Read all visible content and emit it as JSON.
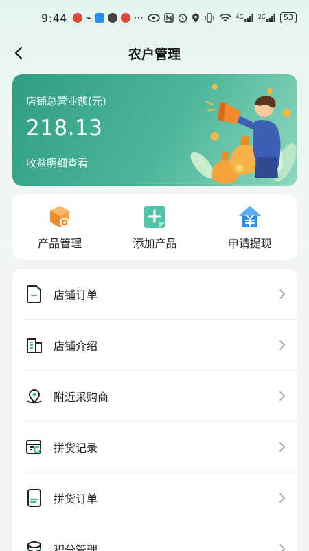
{
  "status_bar": {
    "time": "9:44",
    "left_icons": [
      "weibo-icon",
      "usb-icon",
      "shield-icon",
      "wechat-icon",
      "weibo-icon",
      "more-dots-icon"
    ],
    "right_icons": [
      "eye-icon",
      "nfc-icon",
      "alarm-icon",
      "location-icon",
      "vibrate-icon",
      "wifi-icon",
      "signal-4g-icon",
      "signal-2g-icon"
    ],
    "network_1": "4G",
    "network_2": "2G",
    "battery": "53"
  },
  "header": {
    "title": "农户管理",
    "back_icon": "chevron-left-icon"
  },
  "revenue": {
    "label": "店铺总营业额(元)",
    "amount": "218.13",
    "link": "收益明细查看"
  },
  "quick_actions": [
    {
      "label": "产品管理",
      "icon": "product-box-gear-icon",
      "color": "#f08a2a"
    },
    {
      "label": "添加产品",
      "icon": "add-document-icon",
      "color": "#3cbca0"
    },
    {
      "label": "申请提现",
      "icon": "withdraw-yuan-house-icon",
      "color": "#2a8ef0"
    }
  ],
  "menu": [
    {
      "label": "店铺订单",
      "icon": "document-icon"
    },
    {
      "label": "店铺介绍",
      "icon": "building-icon"
    },
    {
      "label": "附近采购商",
      "icon": "map-pin-icon"
    },
    {
      "label": "拼货记录",
      "icon": "record-refresh-icon"
    },
    {
      "label": "拼货订单",
      "icon": "order-doc-icon"
    },
    {
      "label": "积分管理",
      "icon": "coin-stack-icon"
    }
  ],
  "colors": {
    "accent": "#3cbca0",
    "card_gradient_start": "#2f9e85",
    "card_gradient_end": "#8fd8c0"
  }
}
